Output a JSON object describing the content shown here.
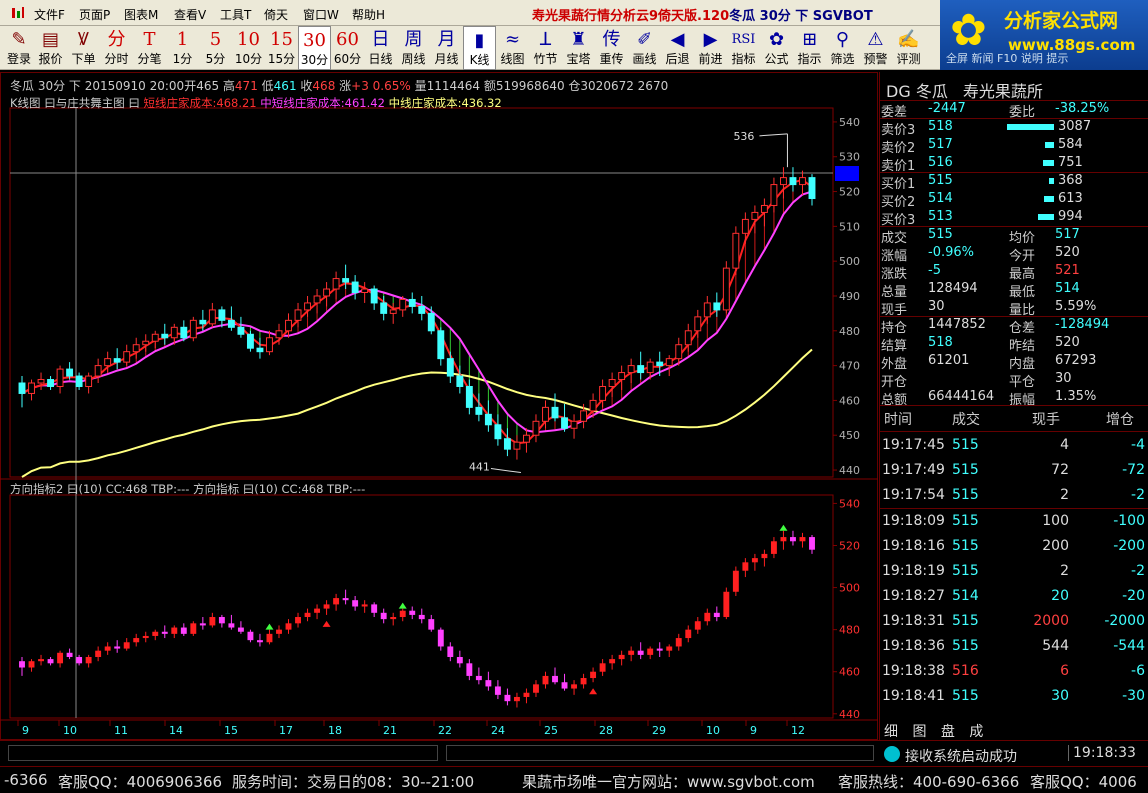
{
  "window": {
    "title_main": "寿光果蔬行情分析云9倚天版.120",
    "title_sub": "冬瓜 30分 下 SGVBOT"
  },
  "menu": [
    "文件F",
    "页面P",
    "图表M",
    "查看V",
    "工具T",
    "倚天",
    "窗口W",
    "帮助H"
  ],
  "toolbar": [
    {
      "glyph": "✎",
      "label": "登录",
      "icon": "login-icon"
    },
    {
      "glyph": "▤",
      "label": "报价",
      "icon": "quote-icon"
    },
    {
      "glyph": "Ꝟ",
      "label": "下单",
      "icon": "order-icon"
    },
    {
      "glyph": "分",
      "label": "分时",
      "icon": "timeshare-icon"
    },
    {
      "glyph": "T",
      "label": "分笔",
      "icon": "tick-icon"
    },
    {
      "glyph": "1",
      "label": "1分",
      "icon": "min1-icon"
    },
    {
      "glyph": "5",
      "label": "5分",
      "icon": "min5-icon"
    },
    {
      "glyph": "10",
      "label": "10分",
      "icon": "min10-icon"
    },
    {
      "glyph": "15",
      "label": "15分",
      "icon": "min15-icon"
    },
    {
      "glyph": "30",
      "label": "30分",
      "icon": "min30-icon"
    },
    {
      "glyph": "60",
      "label": "60分",
      "icon": "min60-icon"
    },
    {
      "glyph": "日",
      "label": "日线",
      "icon": "daily-icon"
    },
    {
      "glyph": "周",
      "label": "周线",
      "icon": "weekly-icon"
    },
    {
      "glyph": "月",
      "label": "月线",
      "icon": "monthly-icon"
    },
    {
      "glyph": "▮",
      "label": "K线",
      "icon": "kline-icon"
    },
    {
      "glyph": "≈",
      "label": "线图",
      "icon": "linechart-icon"
    },
    {
      "glyph": "ꓕ",
      "label": "竹节",
      "icon": "bamboo-icon"
    },
    {
      "glyph": "♜",
      "label": "宝塔",
      "icon": "tower-icon"
    },
    {
      "glyph": "传",
      "label": "重传",
      "icon": "resend-icon"
    },
    {
      "glyph": "✐",
      "label": "画线",
      "icon": "draw-icon"
    },
    {
      "glyph": "◀",
      "label": "后退",
      "icon": "back-icon"
    },
    {
      "glyph": "▶",
      "label": "前进",
      "icon": "forward-icon"
    },
    {
      "glyph": "RSI",
      "label": "指标",
      "icon": "indicator-icon"
    },
    {
      "glyph": "✿",
      "label": "公式",
      "icon": "formula-icon"
    },
    {
      "glyph": "⊞",
      "label": "指示",
      "icon": "hint-icon"
    },
    {
      "glyph": "⚲",
      "label": "筛选",
      "icon": "filter-icon"
    },
    {
      "glyph": "⚠",
      "label": "预警",
      "icon": "alert-icon"
    },
    {
      "glyph": "✍",
      "label": "评测",
      "icon": "evaluate-icon"
    },
    {
      "glyph": "▣",
      "label": "全屏",
      "icon": "fullscreen-icon"
    },
    {
      "glyph": "✉",
      "label": "新闻",
      "icon": "news-icon"
    },
    {
      "glyph": "F10",
      "label": "F10",
      "icon": "f10-icon"
    },
    {
      "glyph": "?",
      "label": "说明",
      "icon": "help-icon"
    },
    {
      "glyph": "!",
      "label": "提示",
      "icon": "tip-icon"
    }
  ],
  "brand": {
    "name": "分析家公式网",
    "url": "www.88gs.com"
  },
  "chart_header": {
    "info": "冬瓜 30分 下 20150910 20:00开465 高",
    "high": "471",
    "low_label": "低",
    "low": "461",
    "close_label": "收",
    "close": "468",
    "change_label": "涨",
    "change": "+3 0.65%",
    "rest": "量1114464 额519968640 仓3020672 2670",
    "ma_title": "K线图 曰与庄共舞主图 曰",
    "ma1": "短线庄家成本:468.21",
    "ma2": "中短线庄家成本:461.42",
    "ma3": "中线庄家成本:436.32",
    "ind_title": "方向指标2 曰(10) CC:468 TBP:--- 方向指标 曰(10) CC:468 TBP:---",
    "peak_label": "536",
    "trough_label": "441"
  },
  "chart_data": [
    {
      "type": "candlestick",
      "title": "",
      "ylim": [
        438,
        544
      ],
      "y_ticks": [
        540,
        530,
        520,
        510,
        500,
        490,
        480,
        470,
        460,
        450,
        440
      ],
      "x_ticks": [
        "9",
        "10",
        "11",
        "14",
        "15",
        "17",
        "18",
        "21",
        "22",
        "24",
        "25",
        "28",
        "29",
        "10",
        "9",
        "12"
      ],
      "series_colors": {
        "up": "#ff3030",
        "down": "#40ffff",
        "ma1": "#ff2020",
        "ma2": "#ff40ff",
        "ma3": "#ffff80",
        "ma2_alt": "#40ff40",
        "ma3_alt": "#2040ff"
      },
      "candles": [
        [
          465,
          467,
          458,
          462
        ],
        [
          462,
          466,
          460,
          465
        ],
        [
          465,
          468,
          463,
          466
        ],
        [
          466,
          467,
          463,
          464
        ],
        [
          464,
          470,
          462,
          469
        ],
        [
          469,
          471,
          466,
          467
        ],
        [
          467,
          468,
          463,
          464
        ],
        [
          464,
          468,
          462,
          467
        ],
        [
          467,
          472,
          465,
          470
        ],
        [
          470,
          474,
          468,
          472
        ],
        [
          472,
          475,
          469,
          471
        ],
        [
          471,
          476,
          470,
          474
        ],
        [
          474,
          478,
          472,
          476
        ],
        [
          476,
          479,
          474,
          477
        ],
        [
          477,
          480,
          475,
          479
        ],
        [
          479,
          482,
          476,
          478
        ],
        [
          478,
          482,
          476,
          481
        ],
        [
          481,
          483,
          477,
          478
        ],
        [
          478,
          484,
          477,
          483
        ],
        [
          483,
          486,
          480,
          482
        ],
        [
          482,
          488,
          481,
          486
        ],
        [
          486,
          487,
          481,
          483
        ],
        [
          483,
          487,
          480,
          481
        ],
        [
          481,
          484,
          478,
          479
        ],
        [
          479,
          480,
          474,
          475
        ],
        [
          475,
          478,
          472,
          474
        ],
        [
          474,
          480,
          473,
          478
        ],
        [
          478,
          482,
          476,
          480
        ],
        [
          480,
          485,
          478,
          483
        ],
        [
          483,
          488,
          481,
          486
        ],
        [
          486,
          490,
          484,
          488
        ],
        [
          488,
          492,
          485,
          490
        ],
        [
          490,
          494,
          487,
          492
        ],
        [
          492,
          497,
          489,
          495
        ],
        [
          495,
          499,
          492,
          494
        ],
        [
          494,
          496,
          489,
          491
        ],
        [
          491,
          494,
          488,
          492
        ],
        [
          492,
          493,
          486,
          488
        ],
        [
          488,
          490,
          483,
          485
        ],
        [
          485,
          488,
          482,
          486
        ],
        [
          486,
          490,
          484,
          489
        ],
        [
          489,
          491,
          485,
          487
        ],
        [
          487,
          490,
          483,
          485
        ],
        [
          485,
          487,
          479,
          480
        ],
        [
          480,
          481,
          470,
          472
        ],
        [
          472,
          474,
          465,
          467
        ],
        [
          467,
          470,
          462,
          464
        ],
        [
          464,
          466,
          456,
          458
        ],
        [
          458,
          462,
          454,
          456
        ],
        [
          456,
          460,
          451,
          453
        ],
        [
          453,
          456,
          447,
          449
        ],
        [
          449,
          452,
          444,
          446
        ],
        [
          446,
          450,
          443,
          448
        ],
        [
          448,
          452,
          445,
          450
        ],
        [
          450,
          456,
          448,
          454
        ],
        [
          454,
          460,
          452,
          458
        ],
        [
          458,
          462,
          454,
          455
        ],
        [
          455,
          459,
          451,
          452
        ],
        [
          452,
          456,
          449,
          454
        ],
        [
          454,
          459,
          452,
          457
        ],
        [
          457,
          462,
          455,
          460
        ],
        [
          460,
          466,
          458,
          464
        ],
        [
          464,
          468,
          461,
          466
        ],
        [
          466,
          470,
          463,
          468
        ],
        [
          468,
          472,
          465,
          470
        ],
        [
          470,
          474,
          466,
          468
        ],
        [
          468,
          472,
          466,
          471
        ],
        [
          471,
          474,
          467,
          470
        ],
        [
          470,
          473,
          467,
          472
        ],
        [
          472,
          478,
          470,
          476
        ],
        [
          476,
          482,
          474,
          480
        ],
        [
          480,
          486,
          478,
          484
        ],
        [
          484,
          490,
          482,
          488
        ],
        [
          488,
          491,
          484,
          486
        ],
        [
          486,
          500,
          485,
          498
        ],
        [
          498,
          510,
          496,
          508
        ],
        [
          508,
          514,
          505,
          512
        ],
        [
          512,
          516,
          508,
          514
        ],
        [
          514,
          518,
          510,
          516
        ],
        [
          516,
          524,
          514,
          522
        ],
        [
          522,
          527,
          518,
          524
        ],
        [
          524,
          527,
          520,
          522
        ],
        [
          522,
          526,
          519,
          524
        ],
        [
          524,
          525,
          516,
          518
        ]
      ],
      "price_labels": {
        "peak": 536,
        "trough": 441
      }
    },
    {
      "type": "bar",
      "title": "",
      "ylim": [
        438,
        544
      ],
      "y_ticks": [
        540,
        520,
        500,
        480,
        460,
        440
      ],
      "colors": {
        "up": "#ff2020",
        "down": "#ff40ff"
      },
      "markers": [
        "up-arrow-green",
        "up-arrow-red"
      ]
    }
  ],
  "quote": {
    "title_code": "DG",
    "title_name": "冬瓜",
    "title_market": "寿光果蔬所",
    "weicha_label": "委差",
    "weicha": "-2447",
    "weibi_label": "委比",
    "weibi": "-38.25%",
    "asks": [
      {
        "label": "卖价3",
        "price": "518",
        "vol": "3087",
        "bar": 0.78
      },
      {
        "label": "卖价2",
        "price": "517",
        "vol": "584",
        "bar": 0.15
      },
      {
        "label": "卖价1",
        "price": "516",
        "vol": "751",
        "bar": 0.19
      }
    ],
    "bids": [
      {
        "label": "买价1",
        "price": "515",
        "vol": "368",
        "bar": 0.09
      },
      {
        "label": "买价2",
        "price": "514",
        "vol": "613",
        "bar": 0.16
      },
      {
        "label": "买价3",
        "price": "513",
        "vol": "994",
        "bar": 0.26
      }
    ],
    "stats": [
      {
        "l1": "成交",
        "v1": "515",
        "c1": "c-cyan",
        "l2": "均价",
        "v2": "517",
        "c2": "c-cyan"
      },
      {
        "l1": "涨幅",
        "v1": "-0.96%",
        "c1": "c-cyan",
        "l2": "今开",
        "v2": "520",
        "c2": "c-white"
      },
      {
        "l1": "涨跌",
        "v1": "-5",
        "c1": "c-cyan",
        "l2": "最高",
        "v2": "521",
        "c2": "c-red"
      },
      {
        "l1": "总量",
        "v1": "128494",
        "c1": "c-white",
        "l2": "最低",
        "v2": "514",
        "c2": "c-cyan"
      },
      {
        "l1": "现手",
        "v1": "30",
        "c1": "c-white",
        "l2": "量比",
        "v2": "5.59%",
        "c2": "c-white"
      },
      {
        "l1": "持仓",
        "v1": "1447852",
        "c1": "c-white",
        "l2": "仓差",
        "v2": "-128494",
        "c2": "c-cyan"
      },
      {
        "l1": "结算",
        "v1": "518",
        "c1": "c-cyan",
        "l2": "昨结",
        "v2": "520",
        "c2": "c-white"
      },
      {
        "l1": "外盘",
        "v1": "61201",
        "c1": "c-white",
        "l2": "内盘",
        "v2": "67293",
        "c2": "c-white"
      },
      {
        "l1": "开仓",
        "v1": "",
        "c1": "c-white",
        "l2": "平仓",
        "v2": "30",
        "c2": "c-white"
      },
      {
        "l1": "总额",
        "v1": "66444164",
        "c1": "c-white",
        "l2": "振幅",
        "v2": "1.35%",
        "c2": "c-white"
      }
    ],
    "trade_headers": [
      "时间",
      "成交",
      "现手",
      "增仓"
    ],
    "trades": [
      {
        "time": "19:17:45",
        "price": "515",
        "pc": "c-cyan",
        "vol": "4",
        "vc": "c-white",
        "chg": "-4"
      },
      {
        "time": "19:17:49",
        "price": "515",
        "pc": "c-cyan",
        "vol": "72",
        "vc": "c-white",
        "chg": "-72"
      },
      {
        "time": "19:17:54",
        "price": "515",
        "pc": "c-cyan",
        "vol": "2",
        "vc": "c-white",
        "chg": "-2"
      },
      {
        "time": "19:18:09",
        "price": "515",
        "pc": "c-cyan",
        "vol": "100",
        "vc": "c-white",
        "chg": "-100"
      },
      {
        "time": "19:18:16",
        "price": "515",
        "pc": "c-cyan",
        "vol": "200",
        "vc": "c-white",
        "chg": "-200"
      },
      {
        "time": "19:18:19",
        "price": "515",
        "pc": "c-cyan",
        "vol": "2",
        "vc": "c-white",
        "chg": "-2"
      },
      {
        "time": "19:18:27",
        "price": "514",
        "pc": "c-cyan",
        "vol": "20",
        "vc": "c-cyan",
        "chg": "-20"
      },
      {
        "time": "19:18:31",
        "price": "515",
        "pc": "c-cyan",
        "vol": "2000",
        "vc": "c-red",
        "chg": "-2000"
      },
      {
        "time": "19:18:36",
        "price": "515",
        "pc": "c-cyan",
        "vol": "544",
        "vc": "c-white",
        "chg": "-544"
      },
      {
        "time": "19:18:38",
        "price": "516",
        "pc": "c-red",
        "vol": "6",
        "vc": "c-red",
        "chg": "-6"
      },
      {
        "time": "19:18:41",
        "price": "515",
        "pc": "c-cyan",
        "vol": "30",
        "vc": "c-cyan",
        "chg": "-30"
      }
    ],
    "tabs": [
      "细",
      "图",
      "盘",
      "成"
    ]
  },
  "status": {
    "message": "接收系统启动成功",
    "clock": "19:18:33"
  },
  "ticker": {
    "a": "-6366",
    "b": "客服QQ：4006906366",
    "c": "服务时间：交易日的08：30--21:00",
    "d": "果蔬市场唯一官方网站：www.sgvbot.com",
    "e": "客服热线：400-690-6366",
    "f": "客服QQ：4006"
  }
}
